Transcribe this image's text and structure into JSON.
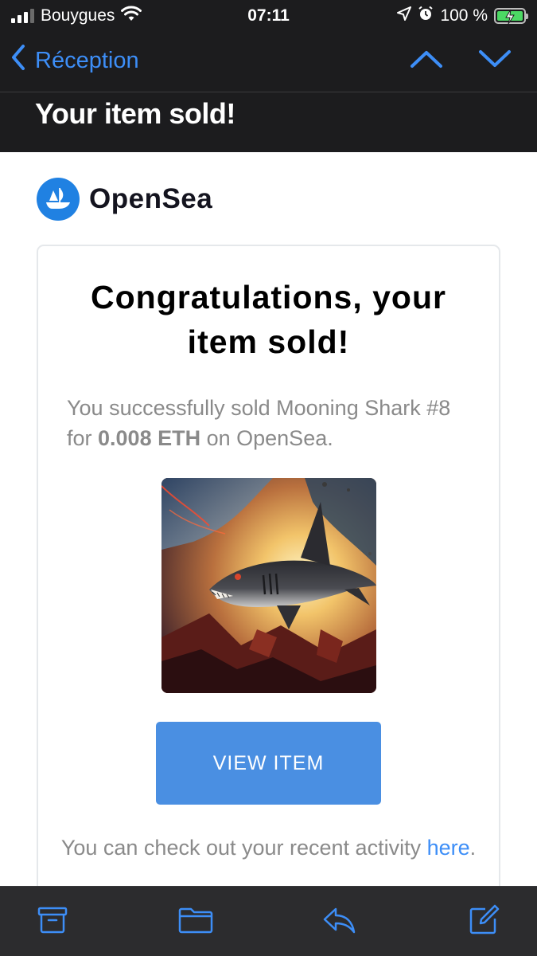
{
  "status_bar": {
    "carrier": "Bouygues",
    "time": "07:11",
    "battery_percent": "100 %"
  },
  "nav": {
    "back_label": "Réception",
    "icons": [
      "chevron-left-icon",
      "chevron-up-icon",
      "chevron-down-icon"
    ]
  },
  "email": {
    "subject": "Your item sold!",
    "brand_name": "OpenSea",
    "card": {
      "title": "Congratulations, your item sold!",
      "desc_prefix": "You successfully sold Mooning Shark #8 for ",
      "desc_amount": "0.008 ETH",
      "desc_suffix": " on OpenSea.",
      "button_label": "VIEW ITEM",
      "footer_text": "You can check out your recent activity ",
      "footer_link": "here",
      "footer_end": "."
    }
  },
  "toolbar": {
    "icons": [
      "archive-icon",
      "folder-icon",
      "reply-icon",
      "compose-icon"
    ]
  },
  "colors": {
    "accent": "#3d8ef7",
    "button": "#4a8fe2",
    "opensea_blue": "#2081e2",
    "dark_bg": "#1c1c1e",
    "toolbar_bg": "#2c2c2e"
  }
}
